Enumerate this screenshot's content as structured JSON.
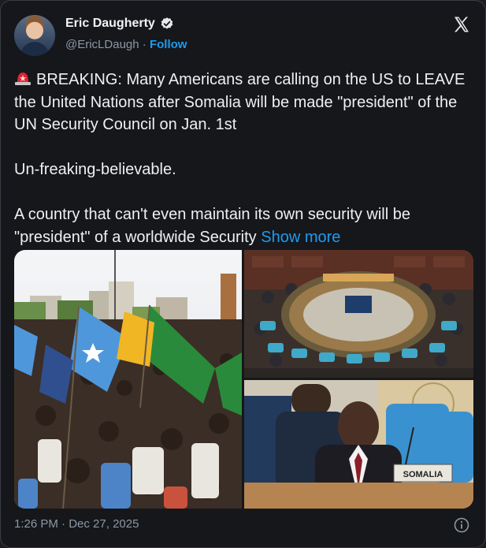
{
  "author": {
    "name": "Eric Daugherty",
    "handle": "@EricLDaugh",
    "separator": "·",
    "follow_label": "Follow",
    "verified_icon": "verified-badge-icon",
    "avatar_icon": "profile-avatar"
  },
  "platform_icon": "x-logo-icon",
  "tweet": {
    "siren_icon": "rotating-light-emoji",
    "paragraph1": "BREAKING: Many Americans are calling on the US to LEAVE the United Nations after Somalia will be made \"president\" of the UN Security Council on Jan. 1st",
    "paragraph2": "Un-freaking-believable.",
    "paragraph3": "A country that can't even maintain its own security will be \"president\" of a worldwide Security",
    "show_more": "Show more"
  },
  "media": {
    "left_image": "somalia-flag-rally-photo",
    "top_right_image": "un-security-council-chamber-photo",
    "bottom_right_image": "somalia-delegate-photo",
    "nameplate": "SOMALIA"
  },
  "footer": {
    "time": "1:26 PM",
    "separator": "·",
    "date": "Dec 27, 2025",
    "info_icon": "info-icon"
  },
  "colors": {
    "background": "#15171b",
    "text": "#e7e9ea",
    "secondary": "#8b98a5",
    "accent": "#1d9bf0"
  }
}
